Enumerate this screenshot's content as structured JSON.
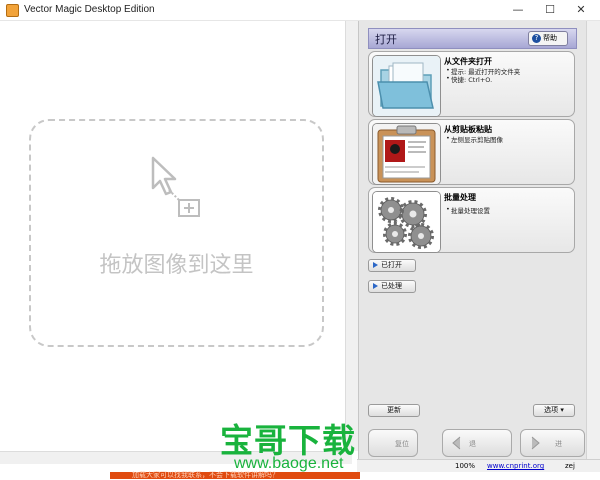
{
  "window": {
    "title": "Vector Magic Desktop Edition",
    "minimize_glyph": "—",
    "maximize_glyph": "☐",
    "close_glyph": "✕"
  },
  "canvas": {
    "drop_text": "拖放图像到这里"
  },
  "panel": {
    "title": "打开",
    "help_label": "帮助",
    "cards": [
      {
        "title": "从文件夹打开",
        "lines": [
          "提示: 最近打开的文件夹",
          "快捷: Ctrl+O."
        ],
        "icon": "folder-icon"
      },
      {
        "title": "从剪贴板粘贴",
        "lines": [
          "左侧显示剪贴图像"
        ],
        "icon": "clipboard-icon"
      },
      {
        "title": "批量处理",
        "lines": [
          "批量处理设置"
        ],
        "icon": "gears-icon"
      }
    ],
    "opened_label": "已打开",
    "processed_label": "已处理",
    "update_label": "更新",
    "options_label": "选项",
    "reset_label": "复位",
    "back_label": "退",
    "forward_label": "进"
  },
  "status": {
    "zoom": "100%",
    "link": "www.cnprint.org",
    "extra": "zej"
  },
  "watermark": {
    "title": "宝哥下载",
    "url": "www.baoge.net"
  },
  "bottom_strip_text": "加载大家可以找我联系，不会下载软件讲解吗？",
  "colors": {
    "accent_green": "#19b33d",
    "panel_header": "#b7b7de",
    "strip": "#e04b10"
  }
}
